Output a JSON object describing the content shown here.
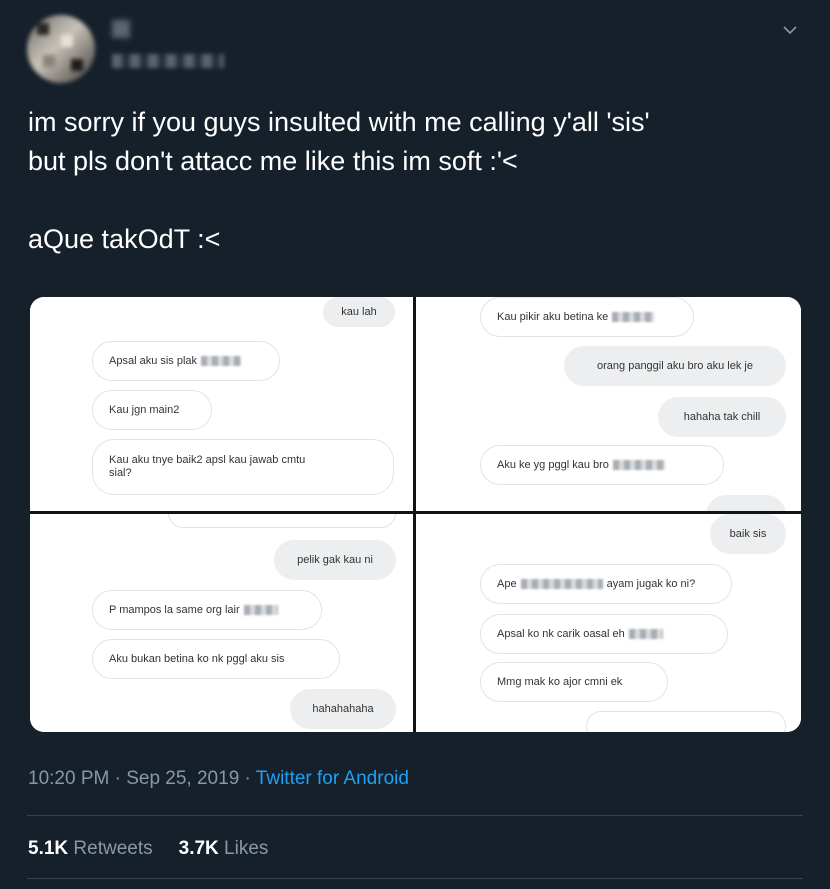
{
  "tweet": {
    "text": "im sorry if you guys insulted with me calling y'all 'sis'\nbut pls don't attacc me like this im soft :'<\n\naQue takOdT :<",
    "timestamp": "10:20 PM · Sep 25, 2019 · ",
    "source": "Twitter for Android",
    "retweets_count": "5.1K",
    "retweets_label": "Retweets",
    "likes_count": "3.7K",
    "likes_label": "Likes",
    "caret_icon": "chevron-down-icon"
  },
  "media": {
    "top_left": [
      "kau lah",
      "Apsal aku sis plak",
      "Kau jgn main2",
      "Kau aku tnye baik2 apsl kau jawab cmtu\nsial?"
    ],
    "top_right": [
      "Kau pikir aku betina ke",
      "orang panggil aku bro aku lek je",
      "hahaha tak chill",
      "Aku ke yg pggl kau bro"
    ],
    "bottom_left": [
      "pelik gak kau ni",
      "P mampos la same org lair",
      "Aku bukan betina ko nk pggl aku sis",
      "hahahahaha"
    ],
    "bottom_right": [
      "baik sis",
      "Ape",
      "ayam jugak ko ni?",
      "Apsal ko nk carik oasal eh",
      "Mmg mak ko ajor cmni ek"
    ]
  }
}
